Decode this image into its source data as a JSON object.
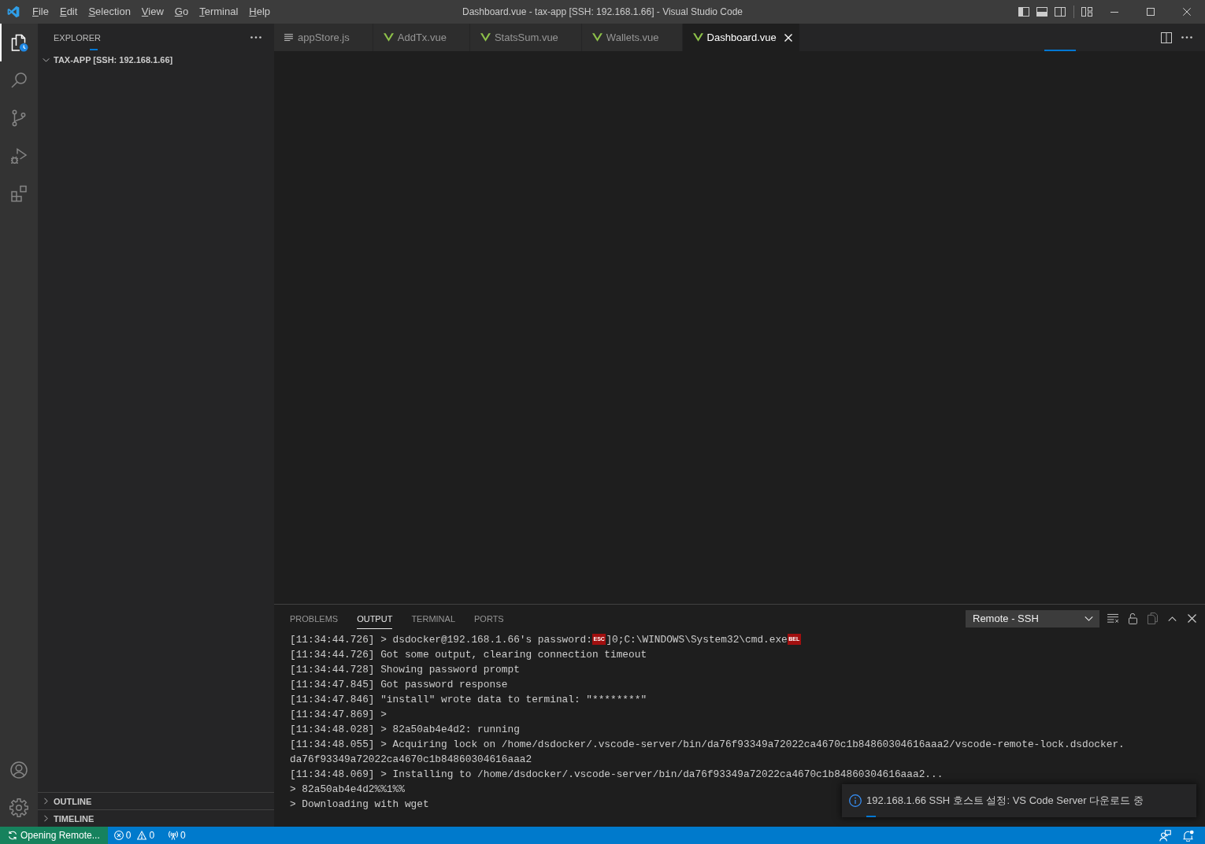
{
  "title_bar": {
    "menu": [
      "File",
      "Edit",
      "Selection",
      "View",
      "Go",
      "Terminal",
      "Help"
    ],
    "title": "Dashboard.vue - tax-app [SSH: 192.168.1.66] - Visual Studio Code"
  },
  "activity_bar": {
    "items": [
      {
        "kind": "explorer",
        "selected": true
      },
      {
        "kind": "search",
        "selected": false
      },
      {
        "kind": "source_control",
        "selected": false
      },
      {
        "kind": "run_debug",
        "selected": false
      },
      {
        "kind": "extensions",
        "selected": false
      }
    ],
    "bottom_items": [
      {
        "kind": "accounts"
      },
      {
        "kind": "settings"
      }
    ]
  },
  "sidebar": {
    "title": "EXPLORER",
    "folder": {
      "label": "TAX-APP [SSH: 192.168.1.66]",
      "expanded": true
    },
    "sections": [
      {
        "label": "OUTLINE",
        "expanded": false
      },
      {
        "label": "TIMELINE",
        "expanded": false
      }
    ]
  },
  "editor": {
    "tabs": [
      {
        "label": "appStore.js",
        "kind": "js",
        "selected": false
      },
      {
        "label": "AddTx.vue",
        "kind": "vue",
        "selected": false
      },
      {
        "label": "StatsSum.vue",
        "kind": "vue",
        "selected": false
      },
      {
        "label": "Wallets.vue",
        "kind": "vue",
        "selected": false
      },
      {
        "label": "Dashboard.vue",
        "kind": "vue",
        "selected": true
      }
    ]
  },
  "panel": {
    "tabs": [
      {
        "label": "PROBLEMS",
        "selected": false
      },
      {
        "label": "OUTPUT",
        "selected": true
      },
      {
        "label": "TERMINAL",
        "selected": false
      },
      {
        "label": "PORTS",
        "selected": false
      }
    ],
    "channel": "Remote - SSH",
    "lines": [
      {
        "parts": [
          {
            "kind": "text",
            "text": "[11:34:44.726] > dsdocker@192.168.1.66's password:"
          },
          {
            "kind": "control",
            "text": "ESC"
          },
          {
            "kind": "text",
            "text": "]0;C:\\WINDOWS\\System32\\cmd.exe"
          },
          {
            "kind": "control",
            "text": "BEL"
          }
        ]
      },
      {
        "text": "[11:34:44.726] Got some output, clearing connection timeout"
      },
      {
        "text": "[11:34:44.728] Showing password prompt"
      },
      {
        "text": "[11:34:47.845] Got password response"
      },
      {
        "text": "[11:34:47.846] \"install\" wrote data to terminal: \"********\""
      },
      {
        "text": "[11:34:47.869] >"
      },
      {
        "text": "[11:34:48.028] > 82a50ab4e4d2: running"
      },
      {
        "text": "[11:34:48.055] > Acquiring lock on /home/dsdocker/.vscode-server/bin/da76f93349a72022ca4670c1b84860304616aaa2/vscode-remote-lock.dsdocker."
      },
      {
        "text": "da76f93349a72022ca4670c1b84860304616aaa2"
      },
      {
        "text": "[11:34:48.069] > Installing to /home/dsdocker/.vscode-server/bin/da76f93349a72022ca4670c1b84860304616aaa2..."
      },
      {
        "text": "> 82a50ab4e4d2%%1%%"
      },
      {
        "text": "> Downloading with wget"
      }
    ]
  },
  "notification": {
    "message": "192.168.1.66 SSH 호스트 설정: VS Code Server 다운로드 중"
  },
  "status_bar": {
    "remote": "Opening Remote...",
    "errors": "0",
    "warnings": "0",
    "ports": "0"
  }
}
